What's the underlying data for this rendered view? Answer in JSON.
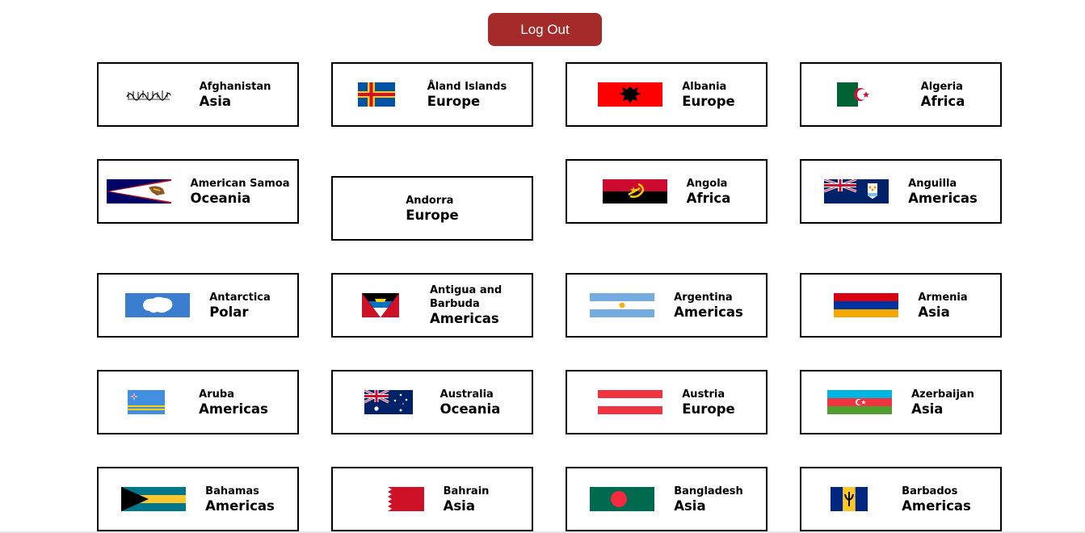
{
  "header": {
    "logout_label": "Log Out"
  },
  "countries": [
    {
      "name": "Afghanistan",
      "region": "Asia",
      "flag": "afghanistan-flag"
    },
    {
      "name": "Åland Islands",
      "region": "Europe",
      "flag": "aland-islands-flag"
    },
    {
      "name": "Albania",
      "region": "Europe",
      "flag": "albania-flag"
    },
    {
      "name": "Algeria",
      "region": "Africa",
      "flag": "algeria-flag"
    },
    {
      "name": "American Samoa",
      "region": "Oceania",
      "flag": "american-samoa-flag"
    },
    {
      "name": "Andorra",
      "region": "Europe",
      "flag": ""
    },
    {
      "name": "Angola",
      "region": "Africa",
      "flag": "angola-flag"
    },
    {
      "name": "Anguilla",
      "region": "Americas",
      "flag": "anguilla-flag"
    },
    {
      "name": "Antarctica",
      "region": "Polar",
      "flag": "antarctica-flag"
    },
    {
      "name": "Antigua and Barbuda",
      "region": "Americas",
      "flag": "antigua-and-barbuda-flag"
    },
    {
      "name": "Argentina",
      "region": "Americas",
      "flag": "argentina-flag"
    },
    {
      "name": "Armenia",
      "region": "Asia",
      "flag": "armenia-flag"
    },
    {
      "name": "Aruba",
      "region": "Americas",
      "flag": "aruba-flag"
    },
    {
      "name": "Australia",
      "region": "Oceania",
      "flag": "australia-flag"
    },
    {
      "name": "Austria",
      "region": "Europe",
      "flag": "austria-flag"
    },
    {
      "name": "Azerbaijan",
      "region": "Asia",
      "flag": "azerbaijan-flag"
    },
    {
      "name": "Bahamas",
      "region": "Americas",
      "flag": "bahamas-flag"
    },
    {
      "name": "Bahrain",
      "region": "Asia",
      "flag": "bahrain-flag"
    },
    {
      "name": "Bangladesh",
      "region": "Asia",
      "flag": "bangladesh-flag"
    },
    {
      "name": "Barbados",
      "region": "Americas",
      "flag": "barbados-flag"
    }
  ]
}
